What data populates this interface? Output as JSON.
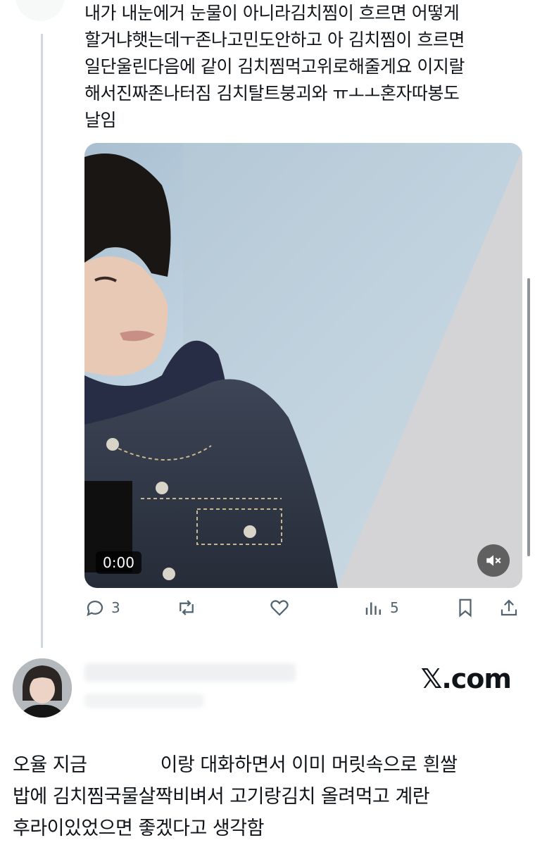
{
  "tweet": {
    "text": "내가 내눈에거 눈물이 아니라김치찜이 흐르면 어떻게\n할거냐햇는데ㅜ존나고민도안하고 아 김치찜이 흐르면\n일단울린다음에 같이 김치찜먹고위로해줄게요 이지랄\n해서진짜존나터짐 김치탈트붕괴와 ㅠㅗㅗ혼자따봉도\n날임",
    "media": {
      "time": "0:00",
      "mute_icon": "volume-mute-icon"
    },
    "actions": {
      "reply_count": "3",
      "retweet_count": "",
      "like_count": "",
      "views_count": "5"
    }
  },
  "quote": {
    "brand": "𝕏.com",
    "text_before": "오율 지금",
    "text_after": "이랑 대화하면서 이미 머릿속으로 흰쌀\n밥에 김치찜국물살짝비벼서 고기랑김치 올려먹고 계란\n후라이있었으면 좋겠다고 생각함"
  },
  "colors": {
    "text": "#0f1419",
    "muted": "#536471",
    "thread_line": "#cfd9de"
  }
}
